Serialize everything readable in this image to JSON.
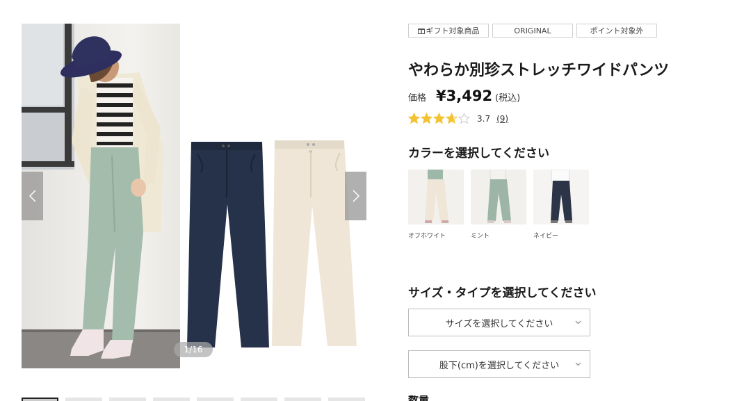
{
  "gallery": {
    "counter": "1/16",
    "prev_label": "‹",
    "next_label": "›",
    "thumbnail_count": 8
  },
  "badges": [
    {
      "label": "ギフト対象商品",
      "icon": "gift-icon"
    },
    {
      "label": "ORIGINAL"
    },
    {
      "label": "ポイント対象外"
    }
  ],
  "product": {
    "title": "やわらか別珍ストレッチワイドパンツ",
    "price_label": "価格",
    "price": "¥3,492",
    "tax_note": "(税込)",
    "rating": 3.7,
    "rating_text": "3.7",
    "review_count": "(9)"
  },
  "color_section": {
    "heading": "カラーを選択してください",
    "options": [
      {
        "label": "オフホワイト",
        "color": "#efe6d8"
      },
      {
        "label": "ミント",
        "color": "#9cb5a6"
      },
      {
        "label": "ネイビー",
        "color": "#2c3548"
      }
    ]
  },
  "size_section": {
    "heading": "サイズ・タイプを選択してください",
    "size_placeholder": "サイズを選択してください",
    "inseam_placeholder": "股下(cm)を選択してください"
  },
  "quantity_section": {
    "heading": "数量"
  },
  "colors": {
    "star": "#f2c230",
    "star_empty": "#cccccc",
    "navy_pants": "#26324a",
    "cream_pants": "#efe6d8",
    "mint_pants": "#a3bcac"
  }
}
